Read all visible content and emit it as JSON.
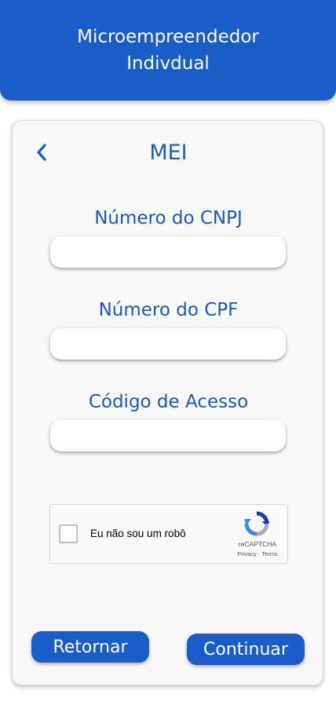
{
  "header": {
    "title": "Microempreendedor Indivdual"
  },
  "card": {
    "title": "MEI"
  },
  "fields": {
    "cnpj": {
      "label": "Número do CNPJ",
      "value": "",
      "placeholder": ""
    },
    "cpf": {
      "label": "Número do CPF",
      "value": "",
      "placeholder": ""
    },
    "access_code": {
      "label": "Código de Acesso",
      "value": "",
      "placeholder": ""
    }
  },
  "recaptcha": {
    "label": "Eu não sou um robô",
    "brand": "reCAPTCHA",
    "links": "Privacy - Terms",
    "checked": false
  },
  "buttons": {
    "back": "Retornar",
    "continue": "Continuar"
  },
  "icons": {
    "back": "chevron-left-icon",
    "recaptcha": "recaptcha-logo-icon"
  },
  "colors": {
    "primary": "#1a5dc8",
    "label": "#1f57b5",
    "card_bg": "#f7f7f7"
  }
}
